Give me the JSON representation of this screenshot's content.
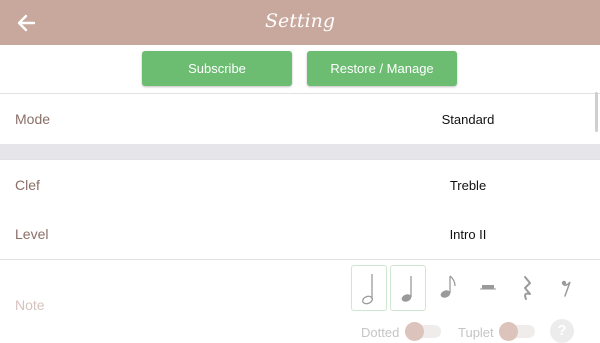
{
  "header": {
    "title": "Setting",
    "back_icon": "arrow-left-icon",
    "background_color": "#c8a79d"
  },
  "actions": {
    "subscribe_label": "Subscribe",
    "restore_label": "Restore / Manage",
    "button_color": "#6cbd72"
  },
  "settings": {
    "mode": {
      "label": "Mode",
      "value": "Standard"
    },
    "clef": {
      "label": "Clef",
      "value": "Treble"
    },
    "level": {
      "label": "Level",
      "value": "Intro II"
    }
  },
  "note": {
    "label": "Note",
    "options": [
      {
        "icon": "half-note-icon",
        "selected": true
      },
      {
        "icon": "quarter-note-icon",
        "selected": true
      },
      {
        "icon": "eighth-note-icon",
        "selected": false
      },
      {
        "icon": "half-rest-icon",
        "selected": false
      },
      {
        "icon": "quarter-rest-icon",
        "selected": false
      },
      {
        "icon": "eighth-rest-icon",
        "selected": false
      }
    ],
    "dotted_label": "Dotted",
    "dotted_on": false,
    "tuplet_label": "Tuplet",
    "tuplet_on": false,
    "help_label": "?"
  }
}
